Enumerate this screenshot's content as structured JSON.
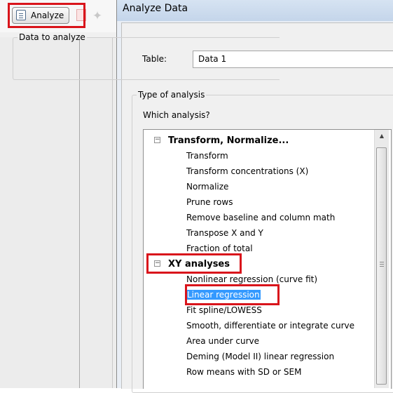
{
  "toolbar": {
    "analyze_label": "Analyze"
  },
  "dialog": {
    "title": "Analyze Data",
    "data_group": {
      "legend": "Data to analyze",
      "table_label": "Table:",
      "table_value": "Data 1"
    },
    "type_group": {
      "legend": "Type of analysis",
      "which_label": "Which analysis?"
    },
    "analysis_tree": [
      {
        "label": "Transform, Normalize...",
        "expander": "−",
        "items": [
          "Transform",
          "Transform concentrations (X)",
          "Normalize",
          "Prune rows",
          "Remove baseline and column math",
          "Transpose X and Y",
          "Fraction of total"
        ]
      },
      {
        "label": "XY analyses",
        "expander": "−",
        "items": [
          "Nonlinear regression (curve fit)",
          "Linear regression",
          "Fit spline/LOWESS",
          "Smooth, differentiate or integrate curve",
          "Area under curve",
          "Deming (Model II) linear regression",
          "Row means with SD or SEM"
        ]
      }
    ],
    "selected_item": "Linear regression"
  },
  "colors": {
    "highlight_box": "#d9141b",
    "selection": "#3399ff"
  },
  "icons": {
    "scroll_up": "▲"
  }
}
